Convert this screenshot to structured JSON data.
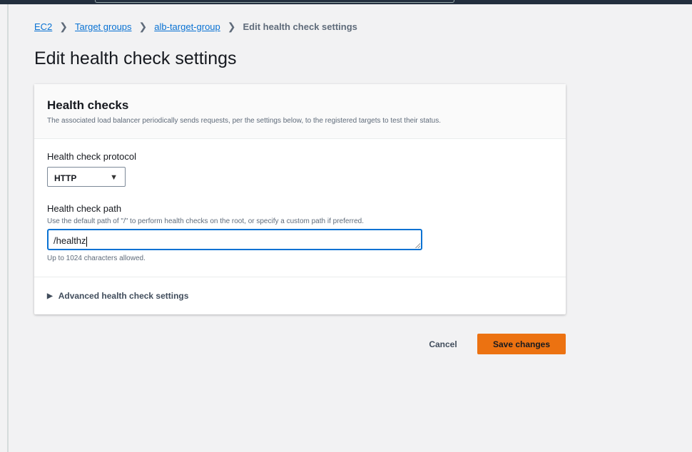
{
  "breadcrumb": [
    {
      "label": "EC2"
    },
    {
      "label": "Target groups"
    },
    {
      "label": "alb-target-group"
    },
    {
      "label": "Edit health check settings"
    }
  ],
  "page_title": "Edit health check settings",
  "card": {
    "title": "Health checks",
    "description": "The associated load balancer periodically sends requests, per the settings below, to the registered targets to test their status.",
    "protocol": {
      "label": "Health check protocol",
      "value": "HTTP"
    },
    "path": {
      "label": "Health check path",
      "description": "Use the default path of \"/\" to perform health checks on the root, or specify a custom path if preferred.",
      "value": "/healthz",
      "constraint": "Up to 1024 characters allowed."
    },
    "advanced_label": "Advanced health check settings"
  },
  "actions": {
    "cancel": "Cancel",
    "save": "Save changes"
  },
  "colors": {
    "primary": "#ec7211",
    "link": "#0972d3",
    "focus": "#0972d3"
  }
}
